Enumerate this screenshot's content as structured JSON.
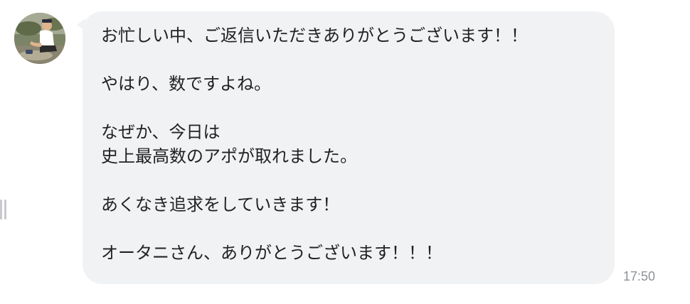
{
  "message": {
    "lines": [
      "お忙しい中、ご返信いただきありがとうございます！！",
      "",
      "やはり、数ですよね。",
      "",
      "なぜか、今日は",
      "史上最高数のアポが取れました。",
      "",
      "あくなき追求をしていきます！",
      "",
      "オータニさん、ありがとうございます！！！"
    ],
    "time": "17:50"
  },
  "colors": {
    "bubble": "#f1f2f4",
    "text": "#222222",
    "timestamp": "#8e9196"
  },
  "icons": {
    "avatar": "user-avatar-photo",
    "left_edge": "scroll-handle-icon"
  }
}
